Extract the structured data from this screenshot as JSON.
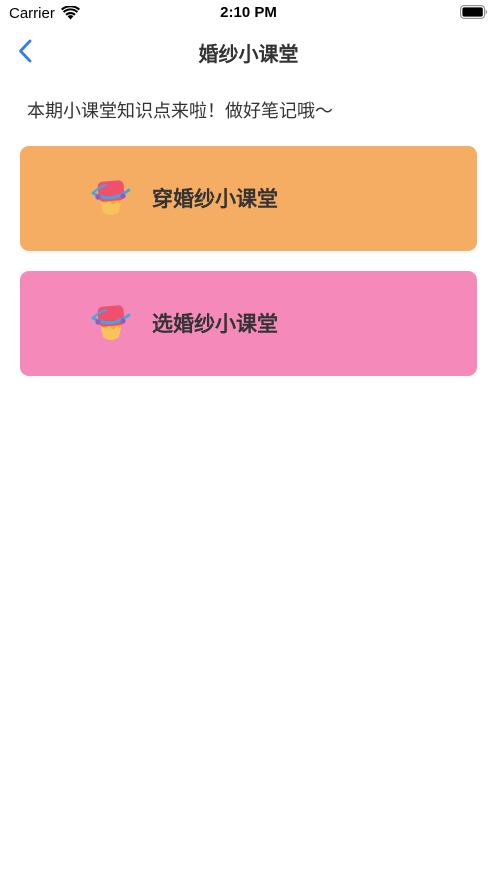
{
  "status_bar": {
    "carrier": "Carrier",
    "time": "2:10 PM",
    "wifi_icon": "wifi-icon",
    "battery_icon": "battery-icon"
  },
  "nav": {
    "title": "婚纱小课堂",
    "back_icon": "chevron-left-icon",
    "accent_color": "#2f80e6"
  },
  "intro": {
    "text": "本期小课堂知识点来啦！做好笔记哦～"
  },
  "lessons": [
    {
      "label": "穿婚纱小课堂",
      "icon": "cake-slice-icon",
      "color": "#f5ac63"
    },
    {
      "label": "选婚纱小课堂",
      "icon": "cake-slice-icon",
      "color": "#f58aba"
    }
  ]
}
